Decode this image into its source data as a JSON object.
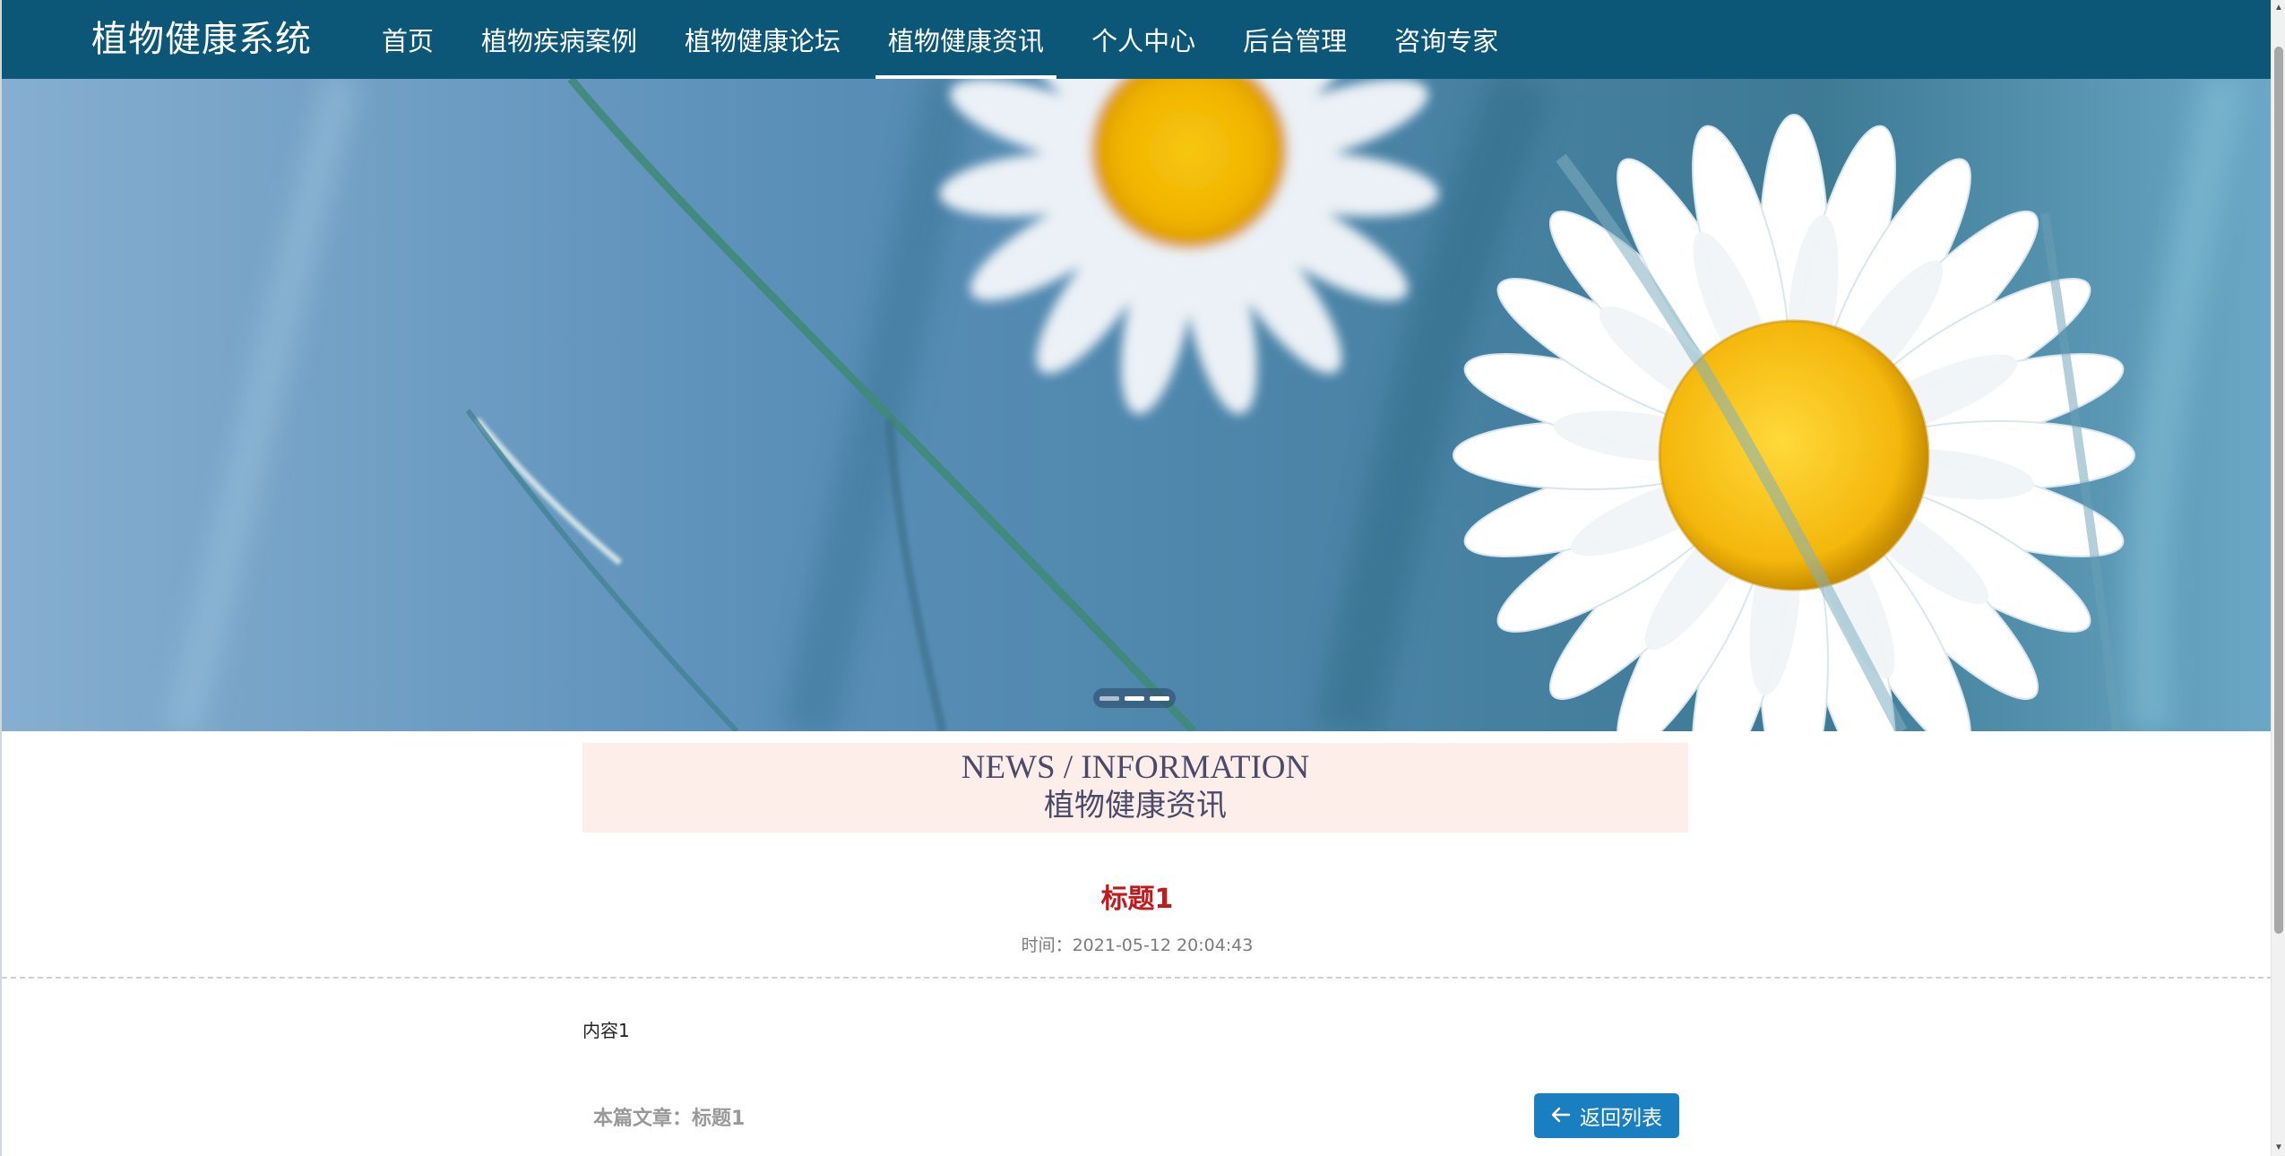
{
  "nav": {
    "brand": "植物健康系统",
    "items": [
      {
        "label": "首页"
      },
      {
        "label": "植物疾病案例"
      },
      {
        "label": "植物健康论坛"
      },
      {
        "label": "植物健康资讯",
        "active": true
      },
      {
        "label": "个人中心"
      },
      {
        "label": "后台管理"
      },
      {
        "label": "咨询专家"
      }
    ]
  },
  "banner": {
    "slide_count": 3,
    "active_slide": 2
  },
  "section": {
    "title_en": "NEWS / INFORMATION",
    "title_cn": "植物健康资讯"
  },
  "article": {
    "title": "标题1",
    "time": "时间：2021-05-12 20:04:43",
    "content": "内容1",
    "this_article": "本篇文章：标题1"
  },
  "actions": {
    "back_label": "返回列表"
  },
  "colors": {
    "navbar": "#0c5677",
    "section_bg": "#fdeeea",
    "title_red": "#c4181b",
    "button_blue": "#1a7fc0"
  },
  "icons": {
    "back": "arrow-left-icon"
  }
}
